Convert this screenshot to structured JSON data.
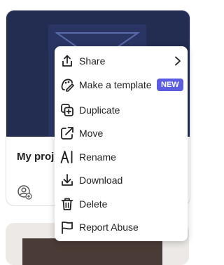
{
  "card": {
    "title": "My proje",
    "thumbnail_color": "#232d52"
  },
  "menu": {
    "items": [
      {
        "label": "Share",
        "icon": "share-icon",
        "has_submenu": true
      },
      {
        "label": "Make a template",
        "icon": "template-icon",
        "badge": "NEW"
      },
      {
        "label": "Duplicate",
        "icon": "duplicate-icon"
      },
      {
        "label": "Move",
        "icon": "move-icon"
      },
      {
        "label": "Rename",
        "icon": "rename-icon"
      },
      {
        "label": "Download",
        "icon": "download-icon"
      },
      {
        "label": "Delete",
        "icon": "trash-icon"
      },
      {
        "label": "Report Abuse",
        "icon": "flag-icon"
      }
    ]
  },
  "colors": {
    "badge": "#5c5ce0",
    "text": "#222222"
  }
}
